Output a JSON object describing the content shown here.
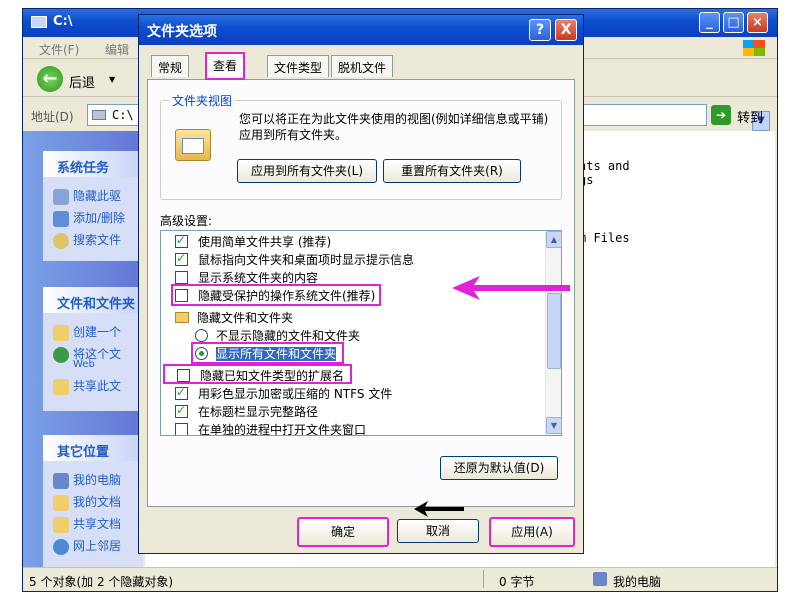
{
  "explorer": {
    "title": "C:\\",
    "menu": [
      "文件(F)",
      "编辑"
    ],
    "back_label": "后退",
    "address_label": "地址(D)",
    "address_value": "C:\\",
    "go_label": "转到",
    "content_lines": [
      "nts and",
      "gs",
      "m Files"
    ],
    "status_left": "5 个对象(加 2 个隐藏对象)",
    "status_size": "0 字节",
    "status_location": "我的电脑"
  },
  "taskpane": {
    "system_tasks": {
      "title": "系统任务",
      "items": [
        "隐藏此驱",
        "添加/删除",
        "搜索文件"
      ]
    },
    "file_tasks": {
      "title": "文件和文件夹",
      "items": [
        "创建一个",
        "将这个文",
        "Web",
        "共享此文"
      ]
    },
    "other_places": {
      "title": "其它位置",
      "items": [
        "我的电脑",
        "我的文档",
        "共享文档",
        "网上邻居"
      ]
    }
  },
  "dialog": {
    "title": "文件夹选项",
    "help_glyph": "?",
    "close_glyph": "X",
    "tabs": [
      "常规",
      "查看",
      "文件类型",
      "脱机文件"
    ],
    "active_tab": "查看",
    "view_group": {
      "title": "文件夹视图",
      "description": "您可以将正在为此文件夹使用的视图(例如详细信息或平铺)应用到所有文件夹。",
      "apply_all_label": "应用到所有文件夹(L)",
      "reset_all_label": "重置所有文件夹(R)"
    },
    "advanced_label": "高级设置:",
    "advanced_items": [
      {
        "type": "checkbox",
        "checked": true,
        "label": "使用简单文件共享 (推荐)"
      },
      {
        "type": "checkbox",
        "checked": true,
        "label": "鼠标指向文件夹和桌面项时显示提示信息"
      },
      {
        "type": "checkbox",
        "checked": false,
        "label": "显示系统文件夹的内容"
      },
      {
        "type": "checkbox",
        "checked": false,
        "label": "隐藏受保护的操作系统文件(推荐)"
      },
      {
        "type": "folder",
        "label": "隐藏文件和文件夹"
      },
      {
        "type": "radio",
        "checked": false,
        "label": "不显示隐藏的文件和文件夹"
      },
      {
        "type": "radio",
        "checked": true,
        "label": "显示所有文件和文件夹"
      },
      {
        "type": "checkbox",
        "checked": false,
        "label": "隐藏已知文件类型的扩展名"
      },
      {
        "type": "checkbox",
        "checked": true,
        "label": "用彩色显示加密或压缩的 NTFS 文件"
      },
      {
        "type": "checkbox",
        "checked": true,
        "label": "在标题栏显示完整路径"
      },
      {
        "type": "checkbox",
        "checked": false,
        "label": "在单独的进程中打开文件夹窗口"
      }
    ],
    "restore_defaults_label": "还原为默认值(D)",
    "ok_label": "确定",
    "cancel_label": "取消",
    "apply_label": "应用(A)"
  },
  "colors": {
    "highlight": "#e321d6",
    "titlebar": "#0e4fd0"
  }
}
